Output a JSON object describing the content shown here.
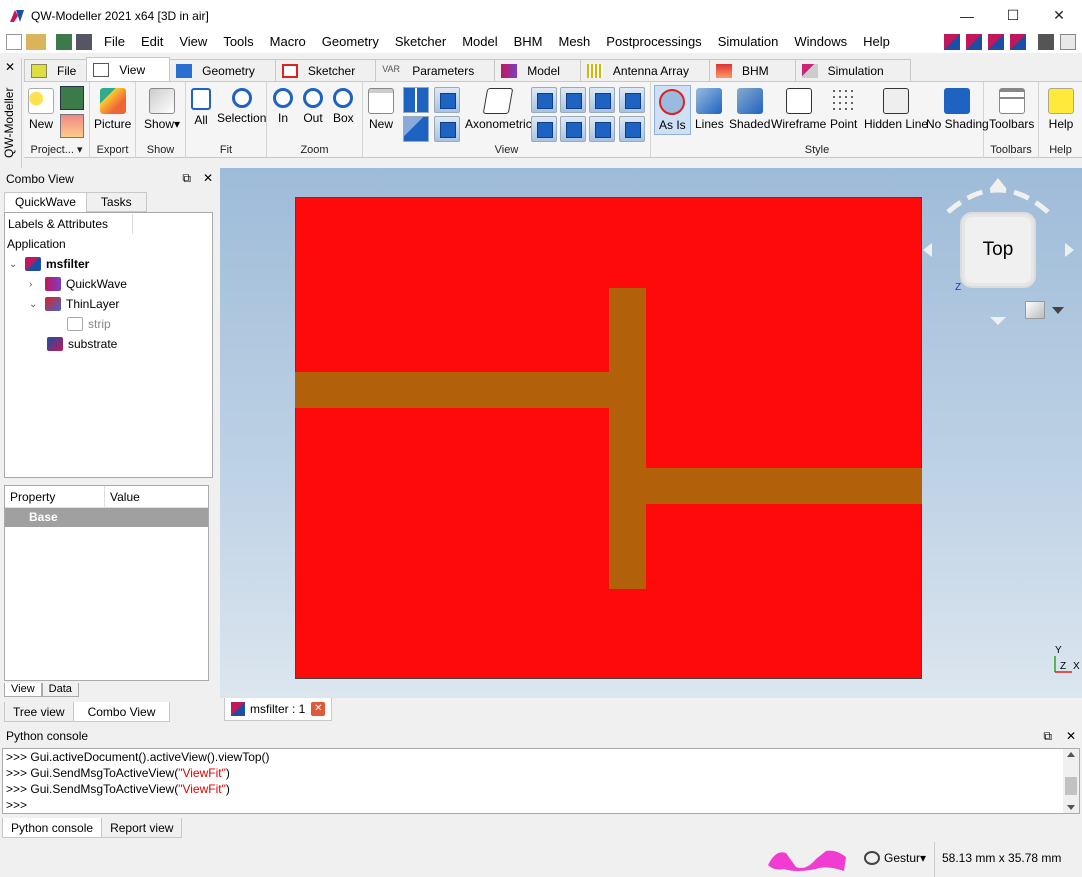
{
  "window": {
    "title": "QW-Modeller 2021 x64 [3D in air]",
    "minimize": "—",
    "maximize": "☐",
    "close": "✕"
  },
  "menu": [
    "File",
    "Edit",
    "View",
    "Tools",
    "Macro",
    "Geometry",
    "Sketcher",
    "Model",
    "BHM",
    "Mesh",
    "Postprocessings",
    "Simulation",
    "Windows",
    "Help"
  ],
  "side_strip": {
    "label": "QW-Modeller",
    "close": "✕"
  },
  "workbench_tabs": [
    "File",
    "View",
    "Geometry",
    "Sketcher",
    "Parameters",
    "Model",
    "Antenna Array",
    "BHM",
    "Simulation"
  ],
  "workbench_active": "View",
  "ribbon": {
    "project": {
      "new": "New",
      "label": "Project... ▾"
    },
    "export": {
      "picture": "Picture",
      "label": "Export"
    },
    "show": {
      "show": "Show▾",
      "label": "Show"
    },
    "fit": {
      "all": "All",
      "selection": "Selection",
      "label": "Fit"
    },
    "zoom": {
      "in": "In",
      "out": "Out",
      "box": "Box",
      "label": "Zoom"
    },
    "view": {
      "new": "New",
      "axonometric": "Axonometric",
      "label": "View"
    },
    "style": {
      "asis": "As Is",
      "lines": "Lines",
      "shaded": "Shaded",
      "wireframe": "Wireframe",
      "point": "Point",
      "hiddenline": "Hidden Line",
      "noshading": "No Shading",
      "label": "Style"
    },
    "toolbars": {
      "toolbars": "Toolbars",
      "label": "Toolbars"
    },
    "help": {
      "help": "Help",
      "label": "Help"
    }
  },
  "combo": {
    "title": "Combo View",
    "tabs": [
      "QuickWave",
      "Tasks"
    ],
    "labels_header": "Labels & Attributes",
    "application": "Application",
    "tree": [
      {
        "label": "msfilter",
        "bold": true
      },
      {
        "label": "QuickWave"
      },
      {
        "label": "ThinLayer"
      },
      {
        "label": "strip",
        "dim": true
      },
      {
        "label": "substrate"
      }
    ],
    "props_headers": [
      "Property",
      "Value"
    ],
    "props_group": "Base",
    "view_data_tabs": [
      "View",
      "Data"
    ],
    "bottom_tabs": [
      "Tree view",
      "Combo View"
    ]
  },
  "viewport": {
    "navcube_label": "Top",
    "axis_y": "Y",
    "axis_z": "Z",
    "axis_x": "X",
    "colors": {
      "substrate": "#fe0a0a",
      "strip": "#b3600b"
    }
  },
  "doc_tab": {
    "label": "msfilter : 1",
    "close": "✕"
  },
  "console": {
    "title": "Python console",
    "lines": [
      {
        "prompt": ">>> ",
        "code": "Gui.activeDocument().activeView().viewTop()",
        "str": ""
      },
      {
        "prompt": ">>> ",
        "code": "Gui.SendMsgToActiveView(",
        "str": "\"ViewFit\"",
        "end": ")"
      },
      {
        "prompt": ">>> ",
        "code": "Gui.SendMsgToActiveView(",
        "str": "\"ViewFit\"",
        "end": ")"
      },
      {
        "prompt": ">>> ",
        "code": "",
        "str": ""
      }
    ],
    "tabs": [
      "Python console",
      "Report view"
    ]
  },
  "status": {
    "gesture": "Gestur▾",
    "dimensions": "58.13 mm x 35.78 mm"
  }
}
